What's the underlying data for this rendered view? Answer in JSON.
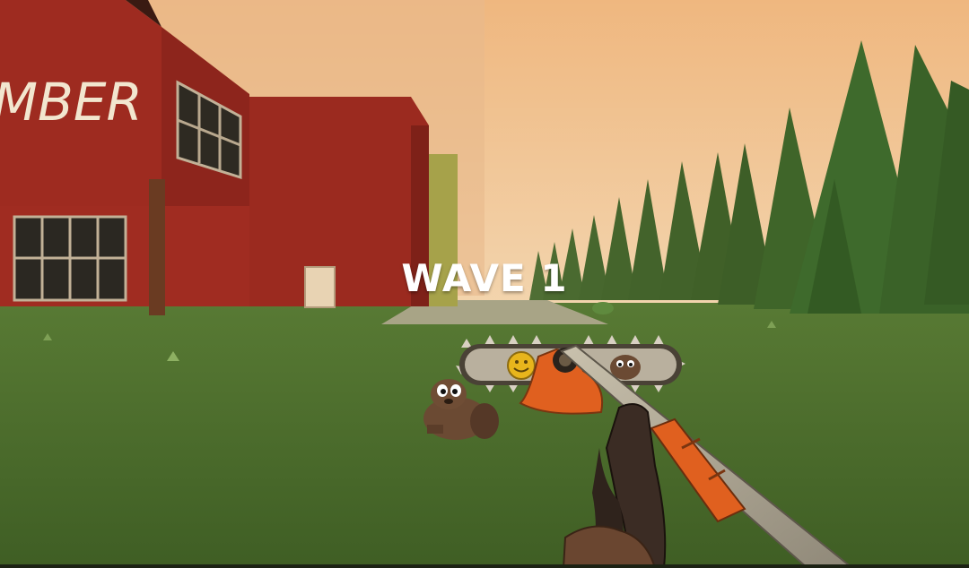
{
  "hud": {
    "wave_label": "WAVE 1"
  },
  "scene": {
    "building_sign": "MBER",
    "sky_color": "#e9c193",
    "grass_color": "#4e6b2e",
    "barn_color": "#9e2b20"
  },
  "weapon": {
    "chainsaw_icons": [
      "smiley-face-icon",
      "beaver-head-icon"
    ],
    "handle_accent": "#e0601f"
  }
}
